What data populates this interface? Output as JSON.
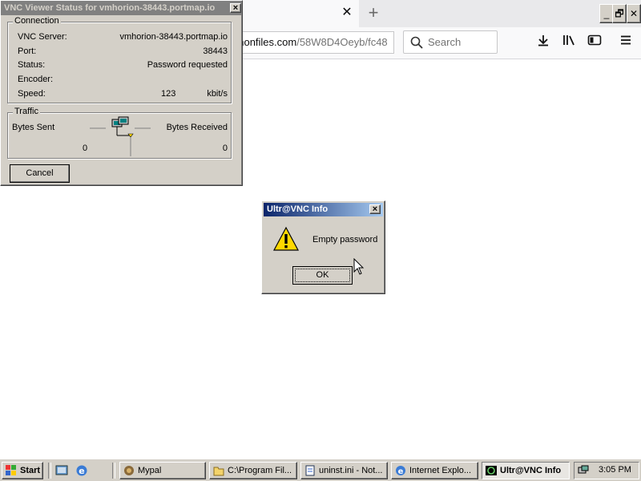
{
  "browser": {
    "url_domain": "anonfiles.com",
    "url_path": "/58W8D4Oeyb/fc48",
    "search_placeholder": "Search",
    "close_tab_glyph": "✕",
    "new_tab_glyph": "+",
    "window_buttons": [
      "_",
      "🗗",
      "✕"
    ],
    "toolbar_icons": [
      "download-icon",
      "library-icon",
      "sidebar-icon",
      "menu-icon"
    ]
  },
  "vnc_status": {
    "title": "VNC Viewer Status for vmhorion-38443.portmap.io",
    "connection_label": "Connection",
    "rows": [
      {
        "label": "VNC Server:",
        "value": "vmhorion-38443.portmap.io"
      },
      {
        "label": "Port:",
        "value": "38443"
      },
      {
        "label": "Status:",
        "value": "Password requested"
      },
      {
        "label": "Encoder:",
        "value": ""
      }
    ],
    "speed_label": "Speed:",
    "speed_value": "123",
    "speed_unit": "kbit/s",
    "traffic_label": "Traffic",
    "bytes_sent_label": "Bytes Sent",
    "bytes_received_label": "Bytes Received",
    "bytes_sent": "0",
    "bytes_received": "0",
    "cancel_label": "Cancel"
  },
  "info_dialog": {
    "title": "Ultr@VNC Info",
    "message": "Empty password",
    "ok_label": "OK"
  },
  "taskbar": {
    "start_label": "Start",
    "tasks": [
      {
        "label": "Mypal",
        "icon": "mypal-icon"
      },
      {
        "label": "C:\\Program Fil...",
        "icon": "folder-icon"
      },
      {
        "label": "uninst.ini - Not...",
        "icon": "notepad-icon"
      },
      {
        "label": "Internet Explo...",
        "icon": "ie-icon"
      },
      {
        "label": "Ultr@VNC Info",
        "icon": "vnc-icon"
      }
    ],
    "clock": "3:05 PM"
  },
  "colors": {
    "title_active": "#0a246a",
    "title_inactive": "#808080",
    "win_face": "#d4d0c8"
  }
}
